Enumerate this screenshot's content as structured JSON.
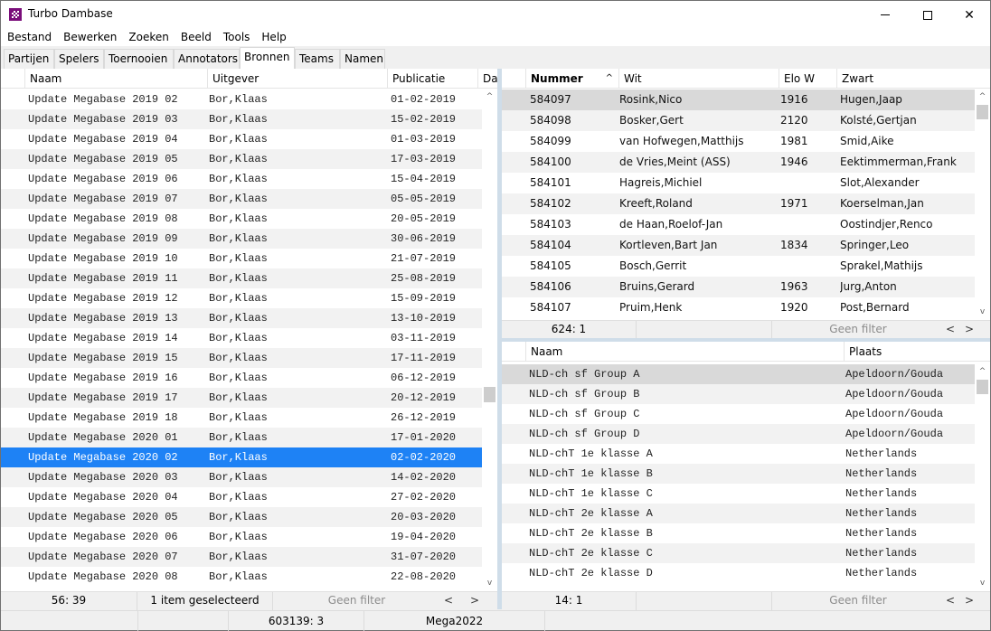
{
  "window": {
    "title": "Turbo Dambase",
    "controls": {
      "minimize": "minimize",
      "maximize": "maximize",
      "close": "✕"
    }
  },
  "menu": [
    "Bestand",
    "Bewerken",
    "Zoeken",
    "Beeld",
    "Tools",
    "Help"
  ],
  "tabs": [
    {
      "label": "Partijen",
      "active": false
    },
    {
      "label": "Spelers",
      "active": false
    },
    {
      "label": "Toernooien",
      "active": false
    },
    {
      "label": "Annotators",
      "active": false
    },
    {
      "label": "Bronnen",
      "active": true
    },
    {
      "label": "Teams",
      "active": false
    },
    {
      "label": "Namen",
      "active": false
    }
  ],
  "sources_panel": {
    "columns": [
      "Naam",
      "Uitgever",
      "Publicatie",
      "Dat"
    ],
    "rows": [
      {
        "naam": "Update Megabase 2019 02",
        "uitgever": "Bor,Klaas",
        "publicatie": "01-02-2019"
      },
      {
        "naam": "Update Megabase 2019 03",
        "uitgever": "Bor,Klaas",
        "publicatie": "15-02-2019"
      },
      {
        "naam": "Update Megabase 2019 04",
        "uitgever": "Bor,Klaas",
        "publicatie": "01-03-2019"
      },
      {
        "naam": "Update Megabase 2019 05",
        "uitgever": "Bor,Klaas",
        "publicatie": "17-03-2019"
      },
      {
        "naam": "Update Megabase 2019 06",
        "uitgever": "Bor,Klaas",
        "publicatie": "15-04-2019"
      },
      {
        "naam": "Update Megabase 2019 07",
        "uitgever": "Bor,Klaas",
        "publicatie": "05-05-2019"
      },
      {
        "naam": "Update Megabase 2019 08",
        "uitgever": "Bor,Klaas",
        "publicatie": "20-05-2019"
      },
      {
        "naam": "Update Megabase 2019 09",
        "uitgever": "Bor,Klaas",
        "publicatie": "30-06-2019"
      },
      {
        "naam": "Update Megabase 2019 10",
        "uitgever": "Bor,Klaas",
        "publicatie": "21-07-2019"
      },
      {
        "naam": "Update Megabase 2019 11",
        "uitgever": "Bor,Klaas",
        "publicatie": "25-08-2019"
      },
      {
        "naam": "Update Megabase 2019 12",
        "uitgever": "Bor,Klaas",
        "publicatie": "15-09-2019"
      },
      {
        "naam": "Update Megabase 2019 13",
        "uitgever": "Bor,Klaas",
        "publicatie": "13-10-2019"
      },
      {
        "naam": "Update Megabase 2019 14",
        "uitgever": "Bor,Klaas",
        "publicatie": "03-11-2019"
      },
      {
        "naam": "Update Megabase 2019 15",
        "uitgever": "Bor,Klaas",
        "publicatie": "17-11-2019"
      },
      {
        "naam": "Update Megabase 2019 16",
        "uitgever": "Bor,Klaas",
        "publicatie": "06-12-2019"
      },
      {
        "naam": "Update Megabase 2019 17",
        "uitgever": "Bor,Klaas",
        "publicatie": "20-12-2019"
      },
      {
        "naam": "Update Megabase 2019 18",
        "uitgever": "Bor,Klaas",
        "publicatie": "26-12-2019"
      },
      {
        "naam": "Update Megabase 2020 01",
        "uitgever": "Bor,Klaas",
        "publicatie": "17-01-2020"
      },
      {
        "naam": "Update Megabase 2020 02",
        "uitgever": "Bor,Klaas",
        "publicatie": "02-02-2020",
        "selected": true
      },
      {
        "naam": "Update Megabase 2020 03",
        "uitgever": "Bor,Klaas",
        "publicatie": "14-02-2020"
      },
      {
        "naam": "Update Megabase 2020 04",
        "uitgever": "Bor,Klaas",
        "publicatie": "27-02-2020"
      },
      {
        "naam": "Update Megabase 2020 05",
        "uitgever": "Bor,Klaas",
        "publicatie": "20-03-2020"
      },
      {
        "naam": "Update Megabase 2020 06",
        "uitgever": "Bor,Klaas",
        "publicatie": "19-04-2020"
      },
      {
        "naam": "Update Megabase 2020 07",
        "uitgever": "Bor,Klaas",
        "publicatie": "31-07-2020"
      },
      {
        "naam": "Update Megabase 2020 08",
        "uitgever": "Bor,Klaas",
        "publicatie": "22-08-2020"
      }
    ],
    "status": {
      "position": "56: 39",
      "selection": "1 item geselecteerd",
      "filter": "Geen filter"
    },
    "scroll_position": 0.62
  },
  "games_panel": {
    "columns": [
      "Nummer",
      "Wit",
      "Elo W",
      "Zwart"
    ],
    "sort_column": "Nummer",
    "rows": [
      {
        "nummer": "584097",
        "wit": "Rosink,Nico",
        "elo": "1916",
        "zwart": "Hugen,Jaap",
        "focus": true
      },
      {
        "nummer": "584098",
        "wit": "Bosker,Gert",
        "elo": "2120",
        "zwart": "Kolsté,Gertjan"
      },
      {
        "nummer": "584099",
        "wit": "van Hofwegen,Matthijs",
        "elo": "1981",
        "zwart": "Smid,Aike"
      },
      {
        "nummer": "584100",
        "wit": "de Vries,Meint (ASS)",
        "elo": "1946",
        "zwart": "Eektimmerman,Frank"
      },
      {
        "nummer": "584101",
        "wit": "Hagreis,Michiel",
        "elo": "",
        "zwart": "Slot,Alexander"
      },
      {
        "nummer": "584102",
        "wit": "Kreeft,Roland",
        "elo": "1971",
        "zwart": "Koerselman,Jan"
      },
      {
        "nummer": "584103",
        "wit": "de Haan,Roelof-Jan",
        "elo": "",
        "zwart": "Oostindjer,Renco"
      },
      {
        "nummer": "584104",
        "wit": "Kortleven,Bart Jan",
        "elo": "1834",
        "zwart": "Springer,Leo"
      },
      {
        "nummer": "584105",
        "wit": "Bosch,Gerrit",
        "elo": "",
        "zwart": "Sprakel,Mathijs"
      },
      {
        "nummer": "584106",
        "wit": "Bruins,Gerard",
        "elo": "1963",
        "zwart": "Jurg,Anton"
      },
      {
        "nummer": "584107",
        "wit": "Pruim,Henk",
        "elo": "1920",
        "zwart": "Post,Bernard"
      }
    ],
    "status": {
      "position": "624: 1",
      "selection": "",
      "filter": "Geen filter"
    }
  },
  "tournaments_panel": {
    "columns": [
      "Naam",
      "Plaats"
    ],
    "rows": [
      {
        "naam": "NLD-ch sf Group A",
        "plaats": "Apeldoorn/Gouda",
        "focus": true
      },
      {
        "naam": "NLD-ch sf Group B",
        "plaats": "Apeldoorn/Gouda"
      },
      {
        "naam": "NLD-ch sf Group C",
        "plaats": "Apeldoorn/Gouda"
      },
      {
        "naam": "NLD-ch sf Group D",
        "plaats": "Apeldoorn/Gouda"
      },
      {
        "naam": "NLD-chT 1e klasse A",
        "plaats": "Netherlands"
      },
      {
        "naam": "NLD-chT 1e klasse B",
        "plaats": "Netherlands"
      },
      {
        "naam": "NLD-chT 1e klasse C",
        "plaats": "Netherlands"
      },
      {
        "naam": "NLD-chT 2e klasse A",
        "plaats": "Netherlands"
      },
      {
        "naam": "NLD-chT 2e klasse B",
        "plaats": "Netherlands"
      },
      {
        "naam": "NLD-chT 2e klasse C",
        "plaats": "Netherlands"
      },
      {
        "naam": "NLD-chT 2e klasse D",
        "plaats": "Netherlands"
      }
    ],
    "status": {
      "position": "14: 1",
      "selection": "",
      "filter": "Geen filter"
    }
  },
  "statusbar": {
    "cell1": "",
    "cell2": "",
    "cell3": "603139: 3",
    "cell4": "Mega2022"
  },
  "icons": {
    "scroll_up": "^",
    "scroll_down": "v",
    "prev": "<",
    "next": ">",
    "sort_asc": "^"
  },
  "colors": {
    "selection": "#1e82f5",
    "focus_row": "#d9d9d9",
    "alt_row": "#f2f2f2",
    "splitter": "#cfdde9",
    "app_icon": "#7a0d7a"
  }
}
